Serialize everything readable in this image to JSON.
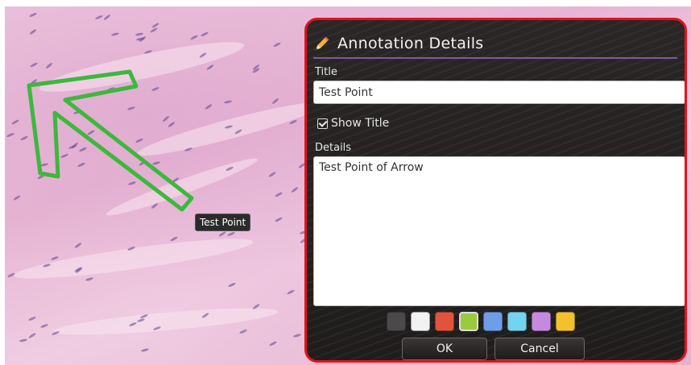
{
  "slide": {
    "annotation_label": "Test Point",
    "arrow_color": "#3cb83c"
  },
  "panel": {
    "header_icon": "pencil-icon",
    "title": "Annotation Details",
    "title_field_label": "Title",
    "title_value": "Test Point",
    "show_title_label": "Show Title",
    "show_title_checked": true,
    "details_field_label": "Details",
    "details_value": "Test Point of Arrow",
    "swatches": [
      {
        "color": "#4a4a4a",
        "name": "swatch-dark-gray"
      },
      {
        "color": "#f2f2f2",
        "name": "swatch-white"
      },
      {
        "color": "#e0533d",
        "name": "swatch-red"
      },
      {
        "color": "#9bcb3c",
        "name": "swatch-green",
        "selected": true
      },
      {
        "color": "#6f9ee8",
        "name": "swatch-blue"
      },
      {
        "color": "#74d3ee",
        "name": "swatch-light-blue"
      },
      {
        "color": "#c58ae0",
        "name": "swatch-purple"
      },
      {
        "color": "#f2c12e",
        "name": "swatch-yellow"
      }
    ],
    "ok_label": "OK",
    "cancel_label": "Cancel",
    "border_color": "#e3121c"
  }
}
